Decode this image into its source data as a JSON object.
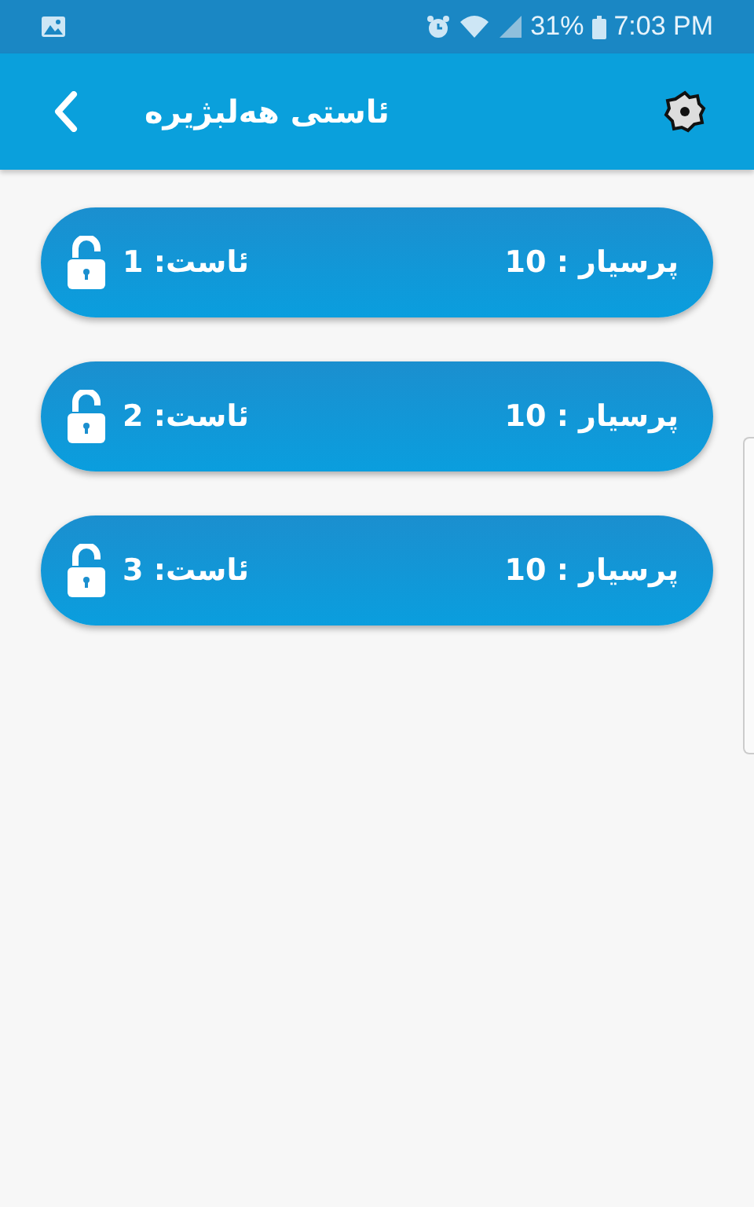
{
  "status_bar": {
    "battery": "31%",
    "time": "7:03 PM"
  },
  "app_bar": {
    "title": "ئاستی هەلبژیرە"
  },
  "levels": [
    {
      "questions": "پرسیار : 10",
      "level": "ئاست: 1",
      "locked": false
    },
    {
      "questions": "پرسیار : 10",
      "level": "ئاست: 2",
      "locked": false
    },
    {
      "questions": "پرسیار : 10",
      "level": "ئاست: 3",
      "locked": false
    }
  ]
}
